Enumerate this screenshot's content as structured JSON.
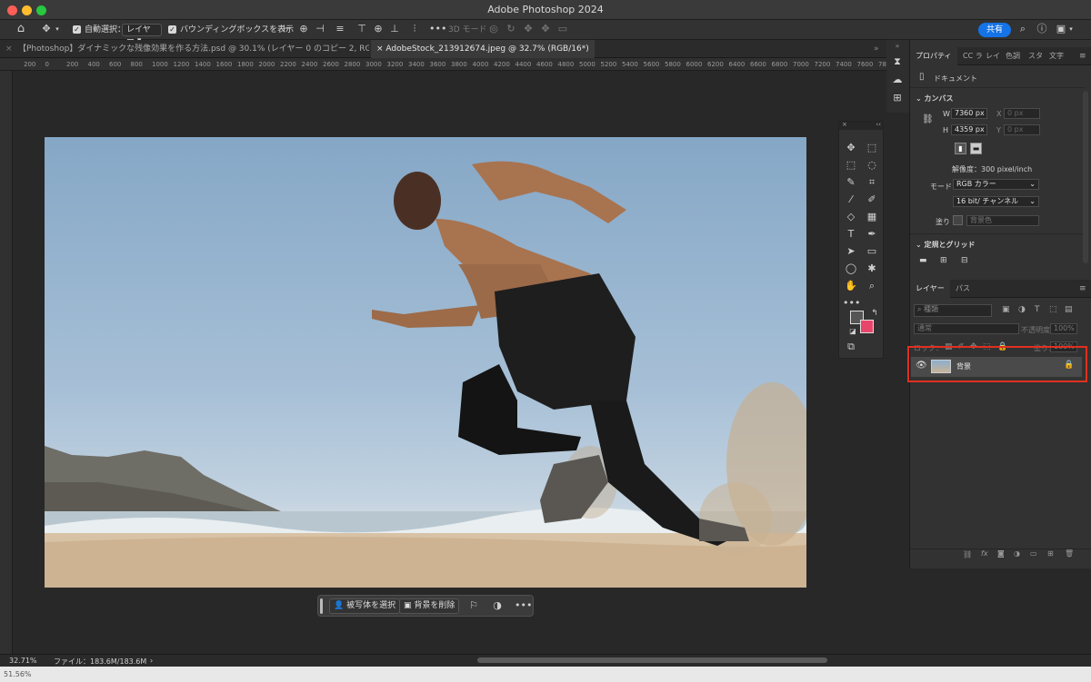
{
  "window": {
    "title": "Adobe Photoshop 2024"
  },
  "options_bar": {
    "auto_select_label": "自動選択：",
    "auto_select_target": "レイヤー",
    "bounding_box_label": "バウンディングボックスを表示",
    "three_d_mode_label": "3D モード :",
    "share_label": "共有"
  },
  "tabs": [
    {
      "label": "【Photoshop】ダイナミックな残像効果を作る方法.psd @ 30.1% (レイヤー 0 のコピー 2, RGB/16*)"
    },
    {
      "label": "AdobeStock_213912674.jpeg @ 32.7% (RGB/16*)"
    }
  ],
  "ruler_ticks": [
    "200",
    "0",
    "200",
    "400",
    "600",
    "800",
    "1000",
    "1200",
    "1400",
    "1600",
    "1800",
    "2000",
    "2200",
    "2400",
    "2600",
    "2800",
    "3000",
    "3200",
    "3400",
    "3600",
    "3800",
    "4000",
    "4200",
    "4400",
    "4600",
    "4800",
    "5000",
    "5200",
    "5400",
    "5600",
    "5800",
    "6000",
    "6200",
    "6400",
    "6600",
    "6800",
    "7000",
    "7200",
    "7400",
    "7600",
    "7800",
    "8000"
  ],
  "contextual_bar": {
    "select_subject": "被写体を選択",
    "remove_background": "背景を削除"
  },
  "status_bar": {
    "zoom": "32.71%",
    "file_info": "ファイル：183.6M/183.6M",
    "arrow": "›"
  },
  "bottom_left_zoom": "51.56%",
  "properties": {
    "tabs": [
      "プロパティ",
      "CC ラ",
      "レイ",
      "色調",
      "スタ",
      "文字"
    ],
    "doc_label": "ドキュメント",
    "canvas_section": "カンバス",
    "w_label": "W",
    "w_value": "7360 px",
    "h_label": "H",
    "h_value": "4359 px",
    "x_label": "X",
    "x_value": "0 px",
    "y_label": "Y",
    "y_value": "0 px",
    "resolution": "解像度：300 pixel/inch",
    "mode_label": "モード",
    "mode_value": "RGB カラー",
    "bit_value": "16 bit/ チャンネル",
    "fill_label": "塗り",
    "fill_value": "背景色",
    "rulers_section": "定規とグリッド"
  },
  "layers": {
    "tabs": [
      "レイヤー",
      "パス"
    ],
    "kind_filter": "種類",
    "blend_mode": "通常",
    "opacity_label": "不透明度：",
    "opacity_value": "100%",
    "lock_label": "ロック：",
    "fill_label": "塗り：",
    "fill_value": "100%",
    "items": [
      {
        "name": "背景"
      }
    ]
  },
  "colors": {
    "foreground": "#555555",
    "background": "#e8456b",
    "highlight_box": "#e0301f",
    "share_button": "#1473e6"
  }
}
